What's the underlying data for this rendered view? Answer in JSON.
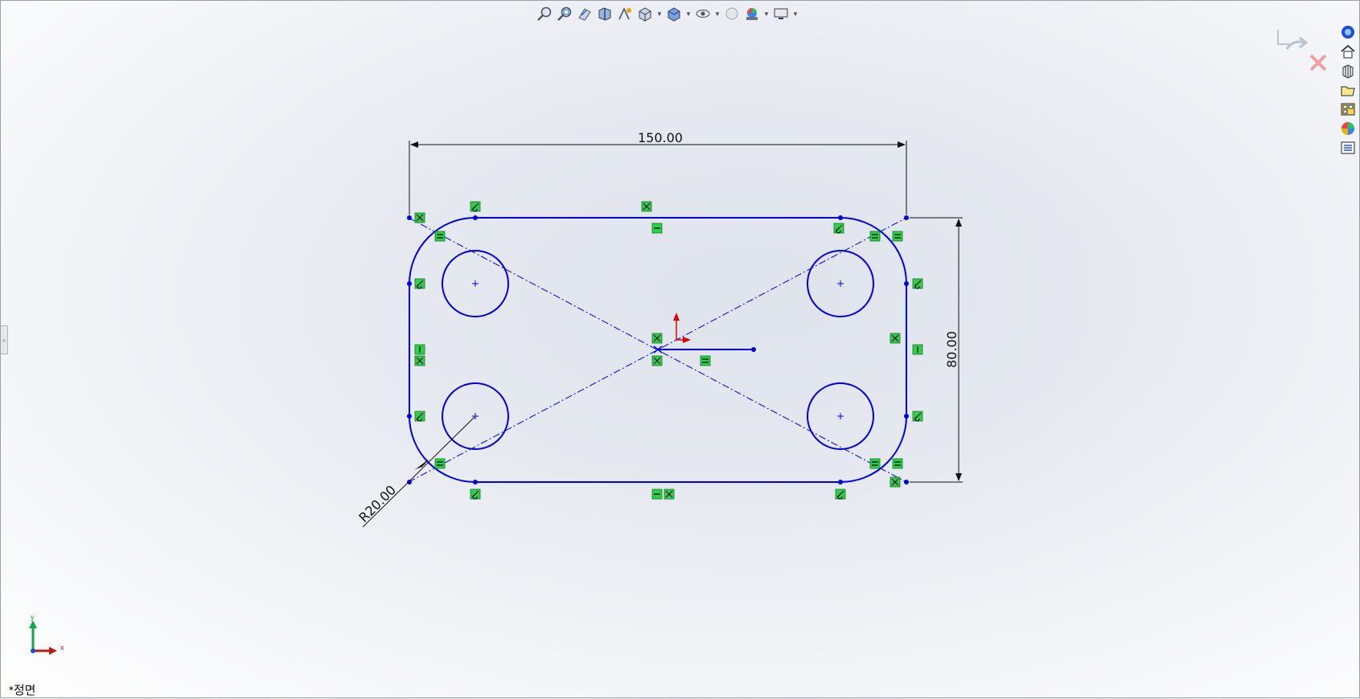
{
  "toolbar": {
    "icons": [
      "zoom-to-fit-icon",
      "zoom-to-area-icon",
      "previous-view-icon",
      "section-view-icon",
      "dynamic-annotation-icon",
      "view-orientation-icon",
      "display-style-icon",
      "hide-show-items-icon",
      "edit-appearance-icon",
      "apply-scene-icon",
      "view-settings-icon"
    ]
  },
  "taskpane": {
    "icons": [
      "solidworks-resources-icon",
      "home-icon",
      "design-library-icon",
      "file-explorer-icon",
      "view-palette-icon",
      "appearances-icon",
      "custom-properties-icon"
    ]
  },
  "sketch": {
    "dim_width": "150.00",
    "dim_height": "80.00",
    "dim_radius": "R20.00",
    "color_sketch": "#0000e0",
    "color_relation": "#2ecf4a"
  },
  "triad": {
    "x_label": "x",
    "y_label": "y"
  },
  "view": {
    "name": "*정면"
  }
}
